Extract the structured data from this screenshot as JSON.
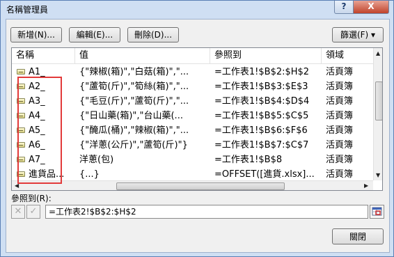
{
  "window": {
    "title": "名稱管理員",
    "help_label": "?",
    "close_label": "X"
  },
  "toolbar": {
    "new_label": "新增(N)...",
    "edit_label": "編輯(E)...",
    "delete_label": "刪除(D)...",
    "filter_label": "篩選(F) ▾"
  },
  "table": {
    "columns": [
      "名稱",
      "值",
      "參照到",
      "領域"
    ],
    "rows": [
      {
        "name": "A1_",
        "value": "{\"辣椒(箱)\",\"白菇(箱)\",\"...",
        "refers_to": "=工作表1!$B$2:$H$2",
        "scope": "活頁簿"
      },
      {
        "name": "A2_",
        "value": "{\"蘆筍(斤)\",\"筍絲(箱)\",\"...",
        "refers_to": "=工作表1!$B$3:$E$3",
        "scope": "活頁簿"
      },
      {
        "name": "A3_",
        "value": "{\"毛豆(斤)\",\"蘆筍(斤)\",\"...",
        "refers_to": "=工作表1!$B$4:$D$4",
        "scope": "活頁簿"
      },
      {
        "name": "A4_",
        "value": "{\"日山藥(箱)\",\"台山藥(...",
        "refers_to": "=工作表1!$B$5:$C$5",
        "scope": "活頁簿"
      },
      {
        "name": "A5_",
        "value": "{\"醃瓜(桶)\",\"辣椒(箱)\",\"...",
        "refers_to": "=工作表1!$B$6:$F$6",
        "scope": "活頁簿"
      },
      {
        "name": "A6_",
        "value": "{\"洋蔥(公斤)\",\"蘆筍(斤)\"}",
        "refers_to": "=工作表1!$B$7:$C$7",
        "scope": "活頁簿"
      },
      {
        "name": "A7_",
        "value": "洋蔥(包)",
        "refers_to": "=工作表1!$B$8",
        "scope": "活頁簿"
      },
      {
        "name": "進貨品...",
        "value": "{...}",
        "refers_to": "=OFFSET([進貨.xlsx]...",
        "scope": "活頁簿"
      }
    ]
  },
  "reference": {
    "label": "參照到(R):",
    "value": "=工作表2!$B$2:$H$2",
    "cancel_icon": "✕",
    "confirm_icon": "✓"
  },
  "footer": {
    "close_label": "關閉"
  }
}
